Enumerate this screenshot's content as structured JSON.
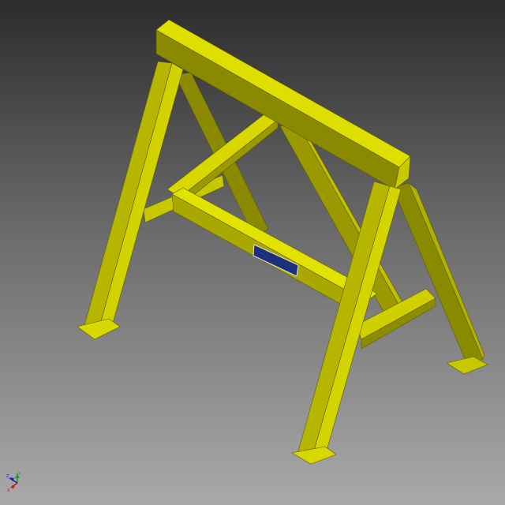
{
  "viewport": {
    "model": "sawhorse",
    "colors": {
      "light": "#e6e600",
      "mid": "#b8b800",
      "dark": "#7f7f00",
      "edge": "#5c5c00",
      "plate": "#1c2f7a"
    }
  },
  "triad": {
    "x_label": "X",
    "y_label": "Y",
    "z_label": "Z",
    "x_color": "#d01010",
    "y_color": "#10a020",
    "z_color": "#1020c0"
  }
}
